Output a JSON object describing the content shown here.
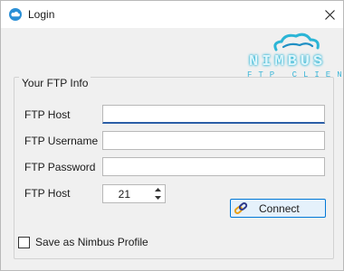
{
  "window": {
    "title": "Login",
    "app_icon": "cloud-icon",
    "close_icon": "close-icon"
  },
  "logo": {
    "wordmark": "NIMBUS",
    "tagline": "FTP CLIENT",
    "icon": "cloud-icon",
    "color": "#2bb5d6"
  },
  "form": {
    "group_title": "Your FTP Info",
    "host_label": "FTP Host",
    "host_value": "",
    "username_label": "FTP Username",
    "username_value": "",
    "password_label": "FTP Password",
    "password_value": "",
    "port_label": "FTP Host",
    "port_value": "21",
    "connect_label": "Connect",
    "connect_icon": "link-chain-icon",
    "save_profile_label": "Save as Nimbus Profile",
    "save_profile_checked": false
  },
  "colors": {
    "accent": "#0078d7",
    "button_bg": "#e5f1fb",
    "focus_underline": "#2b5ea7"
  }
}
